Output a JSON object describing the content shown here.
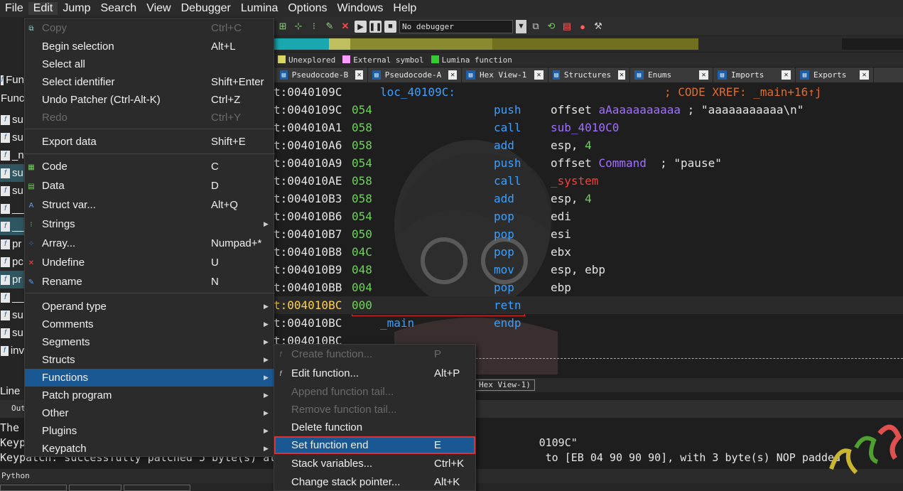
{
  "menubar": [
    "File",
    "Edit",
    "Jump",
    "Search",
    "View",
    "Debugger",
    "Lumina",
    "Options",
    "Windows",
    "Help"
  ],
  "toolbar": {
    "debugger_select": "No debugger"
  },
  "legend": [
    {
      "label": "Unexplored",
      "color": "#d8d860"
    },
    {
      "label": "External symbol",
      "color": "#ff9cff"
    },
    {
      "label": "Lumina function",
      "color": "#33cc33"
    }
  ],
  "tabs": [
    "Pseudocode-B",
    "Pseudocode-A",
    "Hex View-1",
    "Structures",
    "Enums",
    "Imports",
    "Exports"
  ],
  "left_strip": {
    "rows": [
      "Fun",
      "Functi",
      "su",
      "su",
      "_n",
      "su",
      "su",
      "__",
      "__",
      "pr",
      "pc",
      "pr",
      "__",
      "su",
      "su",
      "inv"
    ],
    "line_indicator": "Line",
    "output_tab": "Out"
  },
  "disasm": {
    "lines": [
      {
        "addr": "t:0040109C",
        "label": "loc_40109C:",
        "comment": "; CODE XREF: _main+16↑j"
      },
      {
        "addr": "t:0040109C",
        "bytes": "054",
        "op": "push",
        "arg1": "offset ",
        "arg_sym": "aAaaaaaaaaaa",
        "arg_rest": " ; \"aaaaaaaaaaa\\n\""
      },
      {
        "addr": "t:004010A1",
        "bytes": "058",
        "op": "call",
        "arg_sym": "sub_4010C0"
      },
      {
        "addr": "t:004010A6",
        "bytes": "058",
        "op": "add",
        "arg1": "esp, ",
        "arg_num": "4"
      },
      {
        "addr": "t:004010A9",
        "bytes": "054",
        "op": "push",
        "arg1": "offset ",
        "arg_sym": "Command",
        "arg_rest": "  ; \"pause\""
      },
      {
        "addr": "t:004010AE",
        "bytes": "058",
        "op": "call",
        "arg_sym": "_system"
      },
      {
        "addr": "t:004010B3",
        "bytes": "058",
        "op": "add",
        "arg1": "esp, ",
        "arg_num": "4"
      },
      {
        "addr": "t:004010B6",
        "bytes": "054",
        "op": "pop",
        "arg1": "edi"
      },
      {
        "addr": "t:004010B7",
        "bytes": "050",
        "op": "pop",
        "arg1": "esi"
      },
      {
        "addr": "t:004010B8",
        "bytes": "04C",
        "op": "pop",
        "arg1": "ebx"
      },
      {
        "addr": "t:004010B9",
        "bytes": "048",
        "op": "mov",
        "arg1": "esp, ebp"
      },
      {
        "addr": "t:004010BB",
        "bytes": "004",
        "op": "pop",
        "arg1": "ebp"
      },
      {
        "addr": "t:004010BC",
        "bytes": "000",
        "op": "retn"
      },
      {
        "addr": "t:004010BC",
        "label": "_main",
        "op": "endp"
      },
      {
        "addr": "t:004010BC"
      }
    ]
  },
  "hexbar_tab": "Hex View-1)",
  "output": {
    "lines": [
      "The",
      "Keyp                                                                                0109C\"",
      "Keypatch: successfully patched 5 byte(s) at                                          to [EB 04 90 90 90], with 3 byte(s) NOP padded"
    ],
    "python_label": "Python"
  },
  "edit_menu": [
    {
      "label": "Copy",
      "shortcut": "Ctrl+C",
      "disabled": true,
      "icon": "copy-icon"
    },
    {
      "label": "Begin selection",
      "shortcut": "Alt+L"
    },
    {
      "label": "Select all",
      "shortcut": ""
    },
    {
      "label": "Select identifier",
      "shortcut": "Shift+Enter"
    },
    {
      "label": "Undo Patcher      (Ctrl-Alt-K)",
      "shortcut": "Ctrl+Z"
    },
    {
      "label": "Redo",
      "shortcut": "Ctrl+Y",
      "disabled": true
    },
    {
      "label": "Export data",
      "shortcut": "Shift+E"
    },
    {
      "label": "Code",
      "shortcut": "C",
      "icon": "code-icon"
    },
    {
      "label": "Data",
      "shortcut": "D",
      "icon": "data-icon"
    },
    {
      "label": "Struct var...",
      "shortcut": "Alt+Q",
      "icon": "struct-var-icon"
    },
    {
      "label": "Strings",
      "shortcut": "",
      "icon": "strings-icon",
      "submenu": true
    },
    {
      "label": "Array...",
      "shortcut": "Numpad+*",
      "icon": "array-icon"
    },
    {
      "label": "Undefine",
      "shortcut": "U",
      "icon": "undefine-icon"
    },
    {
      "label": "Rename",
      "shortcut": "N",
      "icon": "rename-icon"
    },
    {
      "label": "Operand type",
      "submenu": true
    },
    {
      "label": "Comments",
      "submenu": true
    },
    {
      "label": "Segments",
      "submenu": true
    },
    {
      "label": "Structs",
      "submenu": true
    },
    {
      "label": "Functions",
      "submenu": true,
      "highlighted": true
    },
    {
      "label": "Patch program",
      "submenu": true
    },
    {
      "label": "Other",
      "submenu": true
    },
    {
      "label": "Plugins",
      "submenu": true
    },
    {
      "label": "Keypatch",
      "submenu": true
    }
  ],
  "functions_menu": [
    {
      "label": "Create function...",
      "shortcut": "P",
      "disabled": true,
      "icon": "function-icon"
    },
    {
      "label": "Edit function...",
      "shortcut": "Alt+P",
      "icon": "function-icon"
    },
    {
      "label": "Append function tail...",
      "shortcut": "",
      "disabled": true
    },
    {
      "label": "Remove function tail...",
      "shortcut": "",
      "disabled": true
    },
    {
      "label": "Delete function",
      "shortcut": ""
    },
    {
      "label": "Set function end",
      "shortcut": "E",
      "highlighted": true
    },
    {
      "label": "Stack variables...",
      "shortcut": "Ctrl+K"
    },
    {
      "label": "Change stack pointer...",
      "shortcut": "Alt+K"
    }
  ],
  "colors": {
    "menu_highlight": "#1a5894",
    "address_current": "#ffd23f",
    "opcode": "#3aa0ff",
    "bytes": "#6fd35a",
    "comment": "#e06c2a",
    "red_box": "#e03030"
  }
}
